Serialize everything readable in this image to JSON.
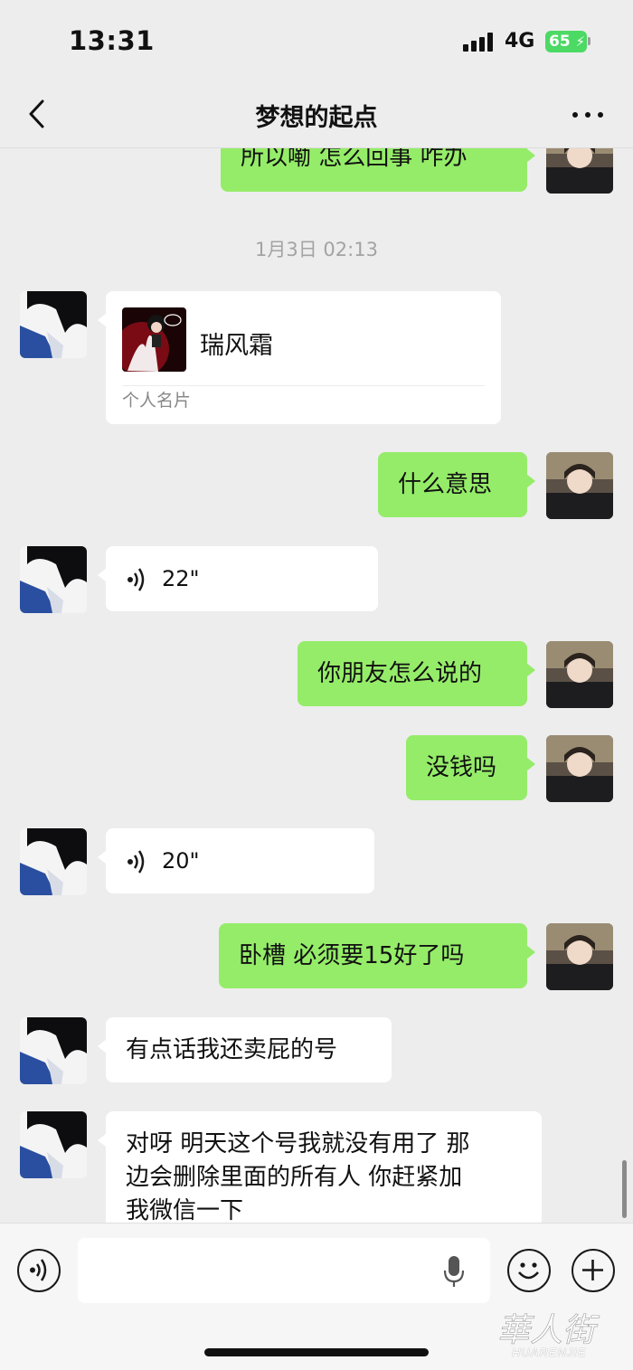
{
  "status_bar": {
    "time": "13:31",
    "network": "4G",
    "battery": "65"
  },
  "header": {
    "title": "梦想的起点"
  },
  "timestamp": "1月3日 02:13",
  "messages": [
    {
      "side": "me",
      "text": "所以嘞  怎么回事  咋办"
    },
    {
      "side": "them",
      "type": "contact_card",
      "name": "瑞风霜",
      "label": "个人名片"
    },
    {
      "side": "me",
      "text": "什么意思"
    },
    {
      "side": "them",
      "type": "voice",
      "duration": "22\""
    },
    {
      "side": "me",
      "text": "你朋友怎么说的"
    },
    {
      "side": "me",
      "text": "没钱吗"
    },
    {
      "side": "them",
      "type": "voice",
      "duration": "20\""
    },
    {
      "side": "me",
      "text": "卧槽  必须要15好了吗"
    },
    {
      "side": "them",
      "text": "有点话我还卖屁的号"
    },
    {
      "side": "them",
      "lines": [
        "对呀 明天这个号我就没有用了 那",
        "边会删除里面的所有人 你赶紧加",
        "我微信一下"
      ]
    }
  ],
  "input_bar": {
    "placeholder": ""
  },
  "watermark": {
    "brand": "HUARENJIE"
  },
  "colors": {
    "self_bubble": "#95ec69",
    "other_bubble": "#ffffff",
    "background": "#ededed"
  }
}
